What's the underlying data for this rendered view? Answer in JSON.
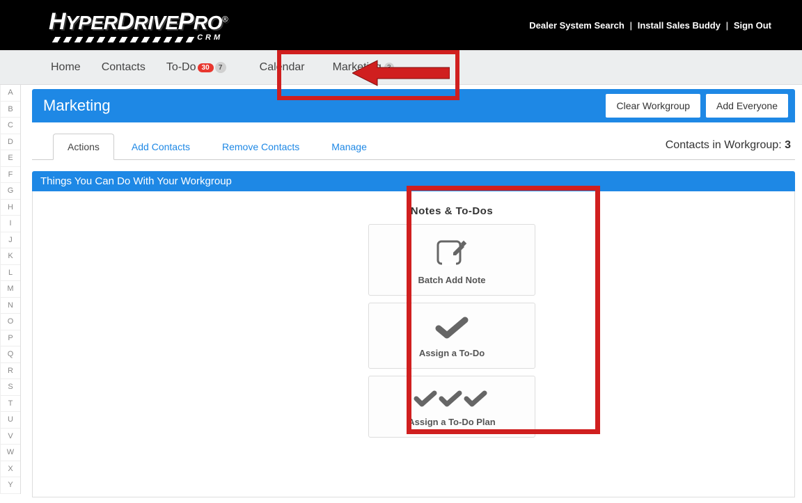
{
  "top_links": {
    "dealer_search": "Dealer System Search",
    "install_buddy": "Install Sales Buddy",
    "sign_out": "Sign Out"
  },
  "logo": {
    "text": "HYPERDRIVE PRO",
    "sub": "CRM"
  },
  "nav": {
    "home": "Home",
    "contacts": "Contacts",
    "todo": "To-Do",
    "todo_badge_red": "30",
    "todo_badge_gray": "7",
    "calendar": "Calendar",
    "marketing": "Marketing",
    "marketing_badge": "3"
  },
  "alpha": [
    "A",
    "B",
    "C",
    "D",
    "E",
    "F",
    "G",
    "H",
    "I",
    "J",
    "K",
    "L",
    "M",
    "N",
    "O",
    "P",
    "Q",
    "R",
    "S",
    "T",
    "U",
    "V",
    "W",
    "X",
    "Y"
  ],
  "page": {
    "title": "Marketing",
    "clear_workgroup": "Clear Workgroup",
    "add_everyone": "Add Everyone"
  },
  "tabs": {
    "actions": "Actions",
    "add_contacts": "Add Contacts",
    "remove_contacts": "Remove Contacts",
    "manage": "Manage"
  },
  "workgroup_label": "Contacts in Workgroup: ",
  "workgroup_count": "3",
  "sub_panel_title": "Things You Can Do With Your Workgroup",
  "cards": {
    "section_title": "Notes & To-Dos",
    "batch_note": "Batch Add Note",
    "assign_todo": "Assign a To-Do",
    "assign_plan": "Assign a To-Do Plan"
  }
}
